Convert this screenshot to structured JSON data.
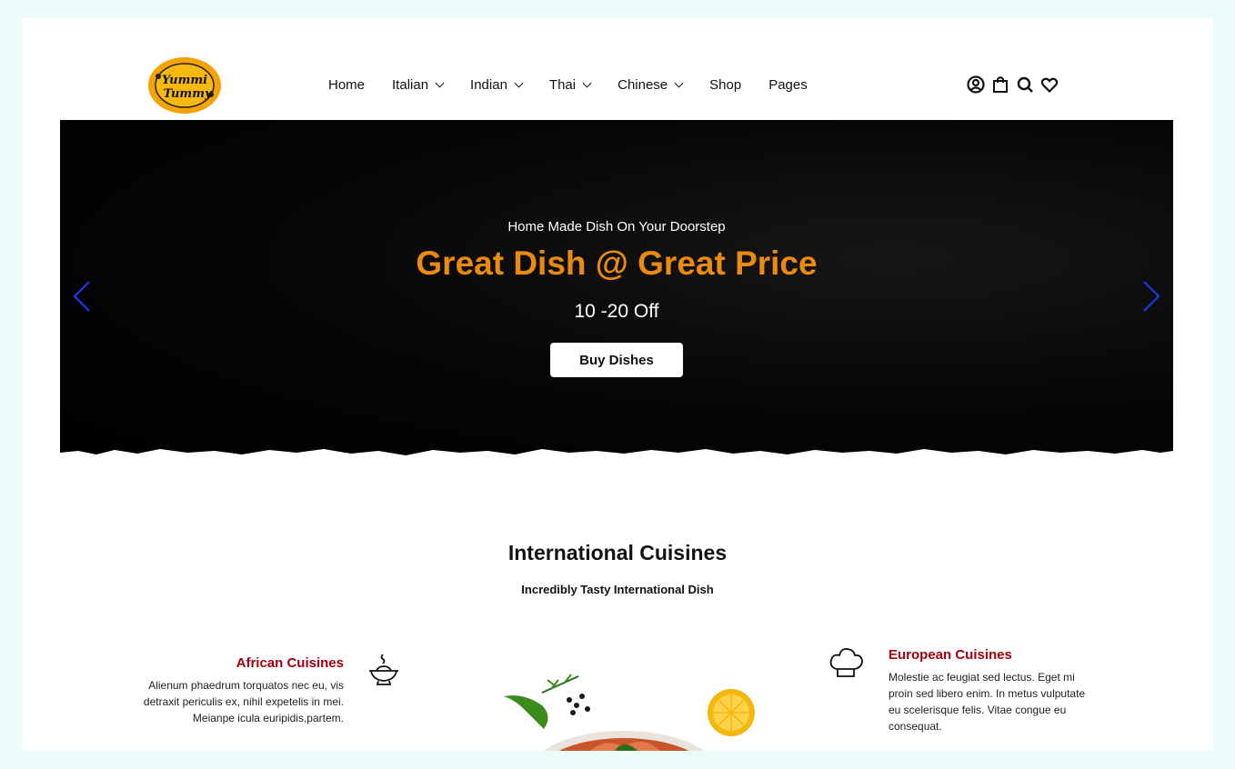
{
  "logo": {
    "line1": "Yummi",
    "line2": "Tummy"
  },
  "nav": {
    "items": [
      "Home",
      "Italian",
      "Indian",
      "Thai",
      "Chinese",
      "Shop",
      "Pages"
    ]
  },
  "hero": {
    "subtitle": "Home Made Dish On Your Doorstep",
    "title": "Great Dish @ Great Price",
    "offer": "10 -20 Off",
    "button": "Buy Dishes"
  },
  "section": {
    "title": "International Cuisines",
    "subtitle": "Incredibly Tasty International Dish"
  },
  "cuisines": {
    "african": {
      "title": "African Cuisines",
      "lines": [
        "Alienum phaedrum torquatos nec eu, vis",
        "detraxit periculis ex, nihil expetelis in mei.",
        "Meianpe icula euripidis,partem."
      ]
    },
    "european": {
      "title": "European Cuisines",
      "lines": [
        "Molestie ac feugiat sed lectus. Eget mi",
        "proin sed libero enim. In metus vulputate",
        "eu scelerisque felis. Vitae congue eu",
        "consequat."
      ]
    }
  },
  "colors": {
    "accent": "#ea8a0f",
    "cuisine_title": "#a1000f",
    "arrow": "#1a3bff",
    "page_bg": "#ebfcfb"
  },
  "icons": [
    "user-circle-icon",
    "shopping-bag-icon",
    "search-icon",
    "heart-icon",
    "chevron-left-icon",
    "chevron-right-icon",
    "steaming-bowl-icon",
    "chef-hat-icon"
  ]
}
